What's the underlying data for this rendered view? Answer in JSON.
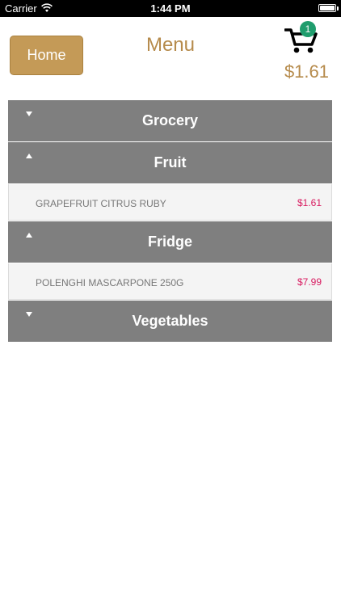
{
  "status_bar": {
    "carrier": "Carrier",
    "time": "1:44 PM"
  },
  "header": {
    "home_label": "Home",
    "title": "Menu",
    "cart_count": "1",
    "cart_total": "$1.61"
  },
  "sections": [
    {
      "title": "Grocery",
      "expanded": false,
      "items": []
    },
    {
      "title": "Fruit",
      "expanded": true,
      "items": [
        {
          "name": "GRAPEFRUIT CITRUS RUBY",
          "price": "$1.61"
        }
      ]
    },
    {
      "title": "Fridge",
      "expanded": true,
      "items": [
        {
          "name": "POLENGHI MASCARPONE 250G",
          "price": "$7.99"
        }
      ]
    },
    {
      "title": "Vegetables",
      "expanded": false,
      "items": []
    }
  ],
  "colors": {
    "accent": "#c49a57",
    "title": "#b68b4c",
    "section_bg": "#7f7f7f",
    "price": "#d81b60",
    "badge": "#1f9d6d"
  },
  "icons": [
    "wifi-icon",
    "battery-icon",
    "cart-icon",
    "chevron-down-icon",
    "chevron-up-icon"
  ]
}
